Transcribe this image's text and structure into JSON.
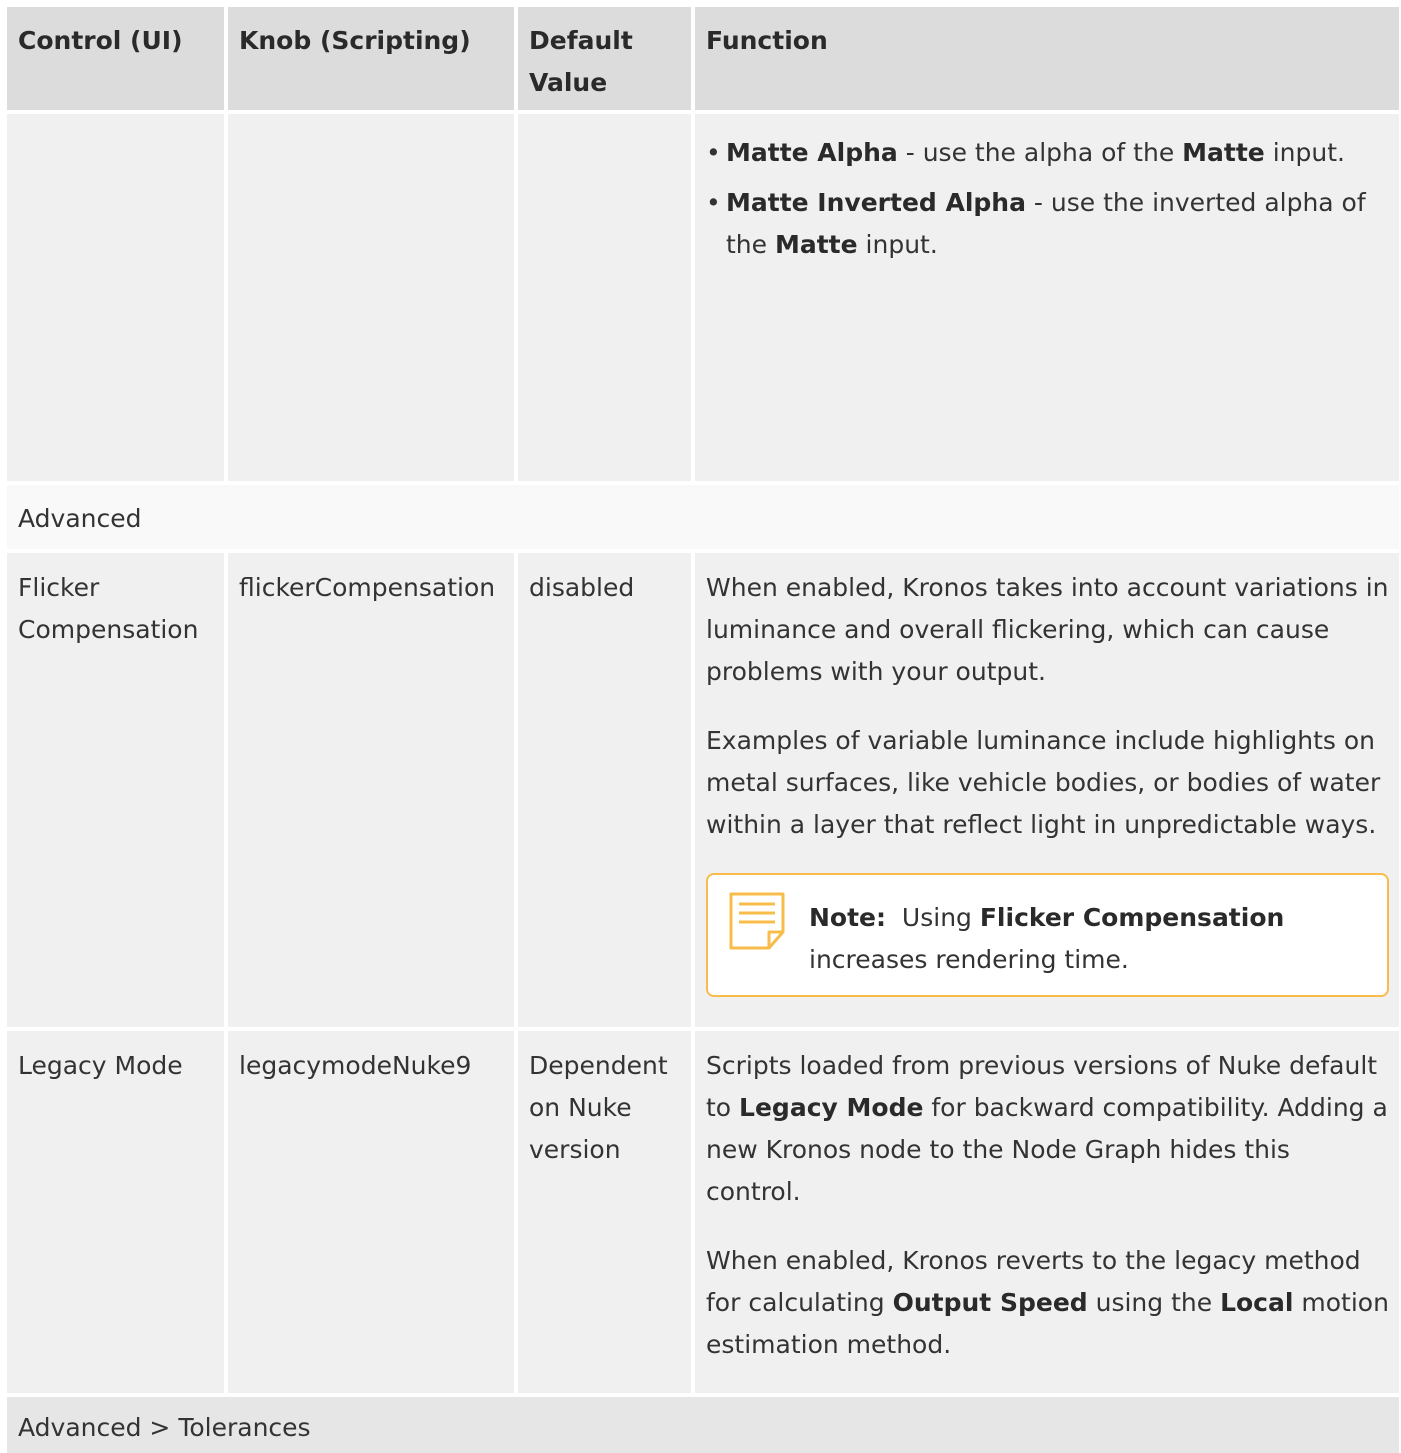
{
  "header": {
    "col1": "Control (UI)",
    "col2": "Knob (Scripting)",
    "col3": "Default Value",
    "col4": "Function"
  },
  "matte_row": {
    "bullets": [
      {
        "term": "Matte Alpha",
        "text1": " - use the alpha of the ",
        "term2": "Matte",
        "text2": " input."
      },
      {
        "term": "Matte Inverted Alpha",
        "text1": " - use the inverted alpha of the ",
        "term2": "Matte",
        "text2": " input."
      }
    ],
    "bullet_char": "•"
  },
  "section_advanced": "Advanced",
  "flicker_row": {
    "control": "Flicker Compensation",
    "knob": "flickerCompensation",
    "default": "disabled",
    "p1": "When enabled, Kronos takes into account variations in luminance and overall flickering, which can cause problems with your output.",
    "p2": "Examples of variable luminance include highlights on metal surfaces, like vehicle bodies, or bodies of water within a layer that reflect light in unpredictable ways.",
    "note": {
      "label": "Note:",
      "text1": "Using ",
      "term": "Flicker Compensation",
      "text2": " increases rendering time.",
      "icon": "note-icon",
      "border_color": "#f7bc4a"
    }
  },
  "legacy_row": {
    "control": "Legacy Mode",
    "knob": "legacymodeNuke9",
    "default": "Dependent on Nuke version",
    "p1_a": "Scripts loaded from previous versions of Nuke default to ",
    "p1_term": "Legacy Mode",
    "p1_b": " for backward compatibility. Adding a new Kronos node to the Node Graph hides this control.",
    "p2_a": "When enabled, Kronos reverts to the legacy method for calculating ",
    "p2_term1": "Output Speed",
    "p2_b": " using the ",
    "p2_term2": "Local",
    "p2_c": " motion estimation method."
  },
  "section_tolerances": "Advanced > Tolerances"
}
